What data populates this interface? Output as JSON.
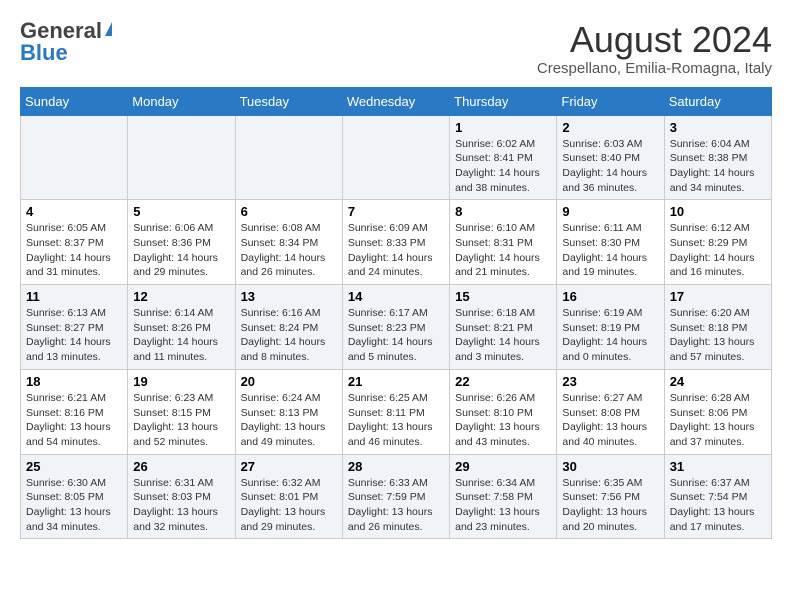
{
  "header": {
    "logo_line1": "General",
    "logo_line2": "Blue",
    "month_year": "August 2024",
    "location": "Crespellano, Emilia-Romagna, Italy"
  },
  "calendar": {
    "days_of_week": [
      "Sunday",
      "Monday",
      "Tuesday",
      "Wednesday",
      "Thursday",
      "Friday",
      "Saturday"
    ],
    "weeks": [
      [
        {
          "day": "",
          "info": ""
        },
        {
          "day": "",
          "info": ""
        },
        {
          "day": "",
          "info": ""
        },
        {
          "day": "",
          "info": ""
        },
        {
          "day": "1",
          "info": "Sunrise: 6:02 AM\nSunset: 8:41 PM\nDaylight: 14 hours and 38 minutes."
        },
        {
          "day": "2",
          "info": "Sunrise: 6:03 AM\nSunset: 8:40 PM\nDaylight: 14 hours and 36 minutes."
        },
        {
          "day": "3",
          "info": "Sunrise: 6:04 AM\nSunset: 8:38 PM\nDaylight: 14 hours and 34 minutes."
        }
      ],
      [
        {
          "day": "4",
          "info": "Sunrise: 6:05 AM\nSunset: 8:37 PM\nDaylight: 14 hours and 31 minutes."
        },
        {
          "day": "5",
          "info": "Sunrise: 6:06 AM\nSunset: 8:36 PM\nDaylight: 14 hours and 29 minutes."
        },
        {
          "day": "6",
          "info": "Sunrise: 6:08 AM\nSunset: 8:34 PM\nDaylight: 14 hours and 26 minutes."
        },
        {
          "day": "7",
          "info": "Sunrise: 6:09 AM\nSunset: 8:33 PM\nDaylight: 14 hours and 24 minutes."
        },
        {
          "day": "8",
          "info": "Sunrise: 6:10 AM\nSunset: 8:31 PM\nDaylight: 14 hours and 21 minutes."
        },
        {
          "day": "9",
          "info": "Sunrise: 6:11 AM\nSunset: 8:30 PM\nDaylight: 14 hours and 19 minutes."
        },
        {
          "day": "10",
          "info": "Sunrise: 6:12 AM\nSunset: 8:29 PM\nDaylight: 14 hours and 16 minutes."
        }
      ],
      [
        {
          "day": "11",
          "info": "Sunrise: 6:13 AM\nSunset: 8:27 PM\nDaylight: 14 hours and 13 minutes."
        },
        {
          "day": "12",
          "info": "Sunrise: 6:14 AM\nSunset: 8:26 PM\nDaylight: 14 hours and 11 minutes."
        },
        {
          "day": "13",
          "info": "Sunrise: 6:16 AM\nSunset: 8:24 PM\nDaylight: 14 hours and 8 minutes."
        },
        {
          "day": "14",
          "info": "Sunrise: 6:17 AM\nSunset: 8:23 PM\nDaylight: 14 hours and 5 minutes."
        },
        {
          "day": "15",
          "info": "Sunrise: 6:18 AM\nSunset: 8:21 PM\nDaylight: 14 hours and 3 minutes."
        },
        {
          "day": "16",
          "info": "Sunrise: 6:19 AM\nSunset: 8:19 PM\nDaylight: 14 hours and 0 minutes."
        },
        {
          "day": "17",
          "info": "Sunrise: 6:20 AM\nSunset: 8:18 PM\nDaylight: 13 hours and 57 minutes."
        }
      ],
      [
        {
          "day": "18",
          "info": "Sunrise: 6:21 AM\nSunset: 8:16 PM\nDaylight: 13 hours and 54 minutes."
        },
        {
          "day": "19",
          "info": "Sunrise: 6:23 AM\nSunset: 8:15 PM\nDaylight: 13 hours and 52 minutes."
        },
        {
          "day": "20",
          "info": "Sunrise: 6:24 AM\nSunset: 8:13 PM\nDaylight: 13 hours and 49 minutes."
        },
        {
          "day": "21",
          "info": "Sunrise: 6:25 AM\nSunset: 8:11 PM\nDaylight: 13 hours and 46 minutes."
        },
        {
          "day": "22",
          "info": "Sunrise: 6:26 AM\nSunset: 8:10 PM\nDaylight: 13 hours and 43 minutes."
        },
        {
          "day": "23",
          "info": "Sunrise: 6:27 AM\nSunset: 8:08 PM\nDaylight: 13 hours and 40 minutes."
        },
        {
          "day": "24",
          "info": "Sunrise: 6:28 AM\nSunset: 8:06 PM\nDaylight: 13 hours and 37 minutes."
        }
      ],
      [
        {
          "day": "25",
          "info": "Sunrise: 6:30 AM\nSunset: 8:05 PM\nDaylight: 13 hours and 34 minutes."
        },
        {
          "day": "26",
          "info": "Sunrise: 6:31 AM\nSunset: 8:03 PM\nDaylight: 13 hours and 32 minutes."
        },
        {
          "day": "27",
          "info": "Sunrise: 6:32 AM\nSunset: 8:01 PM\nDaylight: 13 hours and 29 minutes."
        },
        {
          "day": "28",
          "info": "Sunrise: 6:33 AM\nSunset: 7:59 PM\nDaylight: 13 hours and 26 minutes."
        },
        {
          "day": "29",
          "info": "Sunrise: 6:34 AM\nSunset: 7:58 PM\nDaylight: 13 hours and 23 minutes."
        },
        {
          "day": "30",
          "info": "Sunrise: 6:35 AM\nSunset: 7:56 PM\nDaylight: 13 hours and 20 minutes."
        },
        {
          "day": "31",
          "info": "Sunrise: 6:37 AM\nSunset: 7:54 PM\nDaylight: 13 hours and 17 minutes."
        }
      ]
    ]
  }
}
